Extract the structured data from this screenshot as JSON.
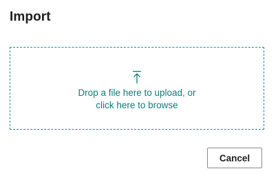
{
  "dialog": {
    "title": "Import"
  },
  "dropzone": {
    "icon": "upload-arrow-icon",
    "line1": "Drop a file here to upload, or",
    "line2": "click here to browse",
    "accent_color": "#0f7b78"
  },
  "actions": {
    "cancel_label": "Cancel"
  }
}
